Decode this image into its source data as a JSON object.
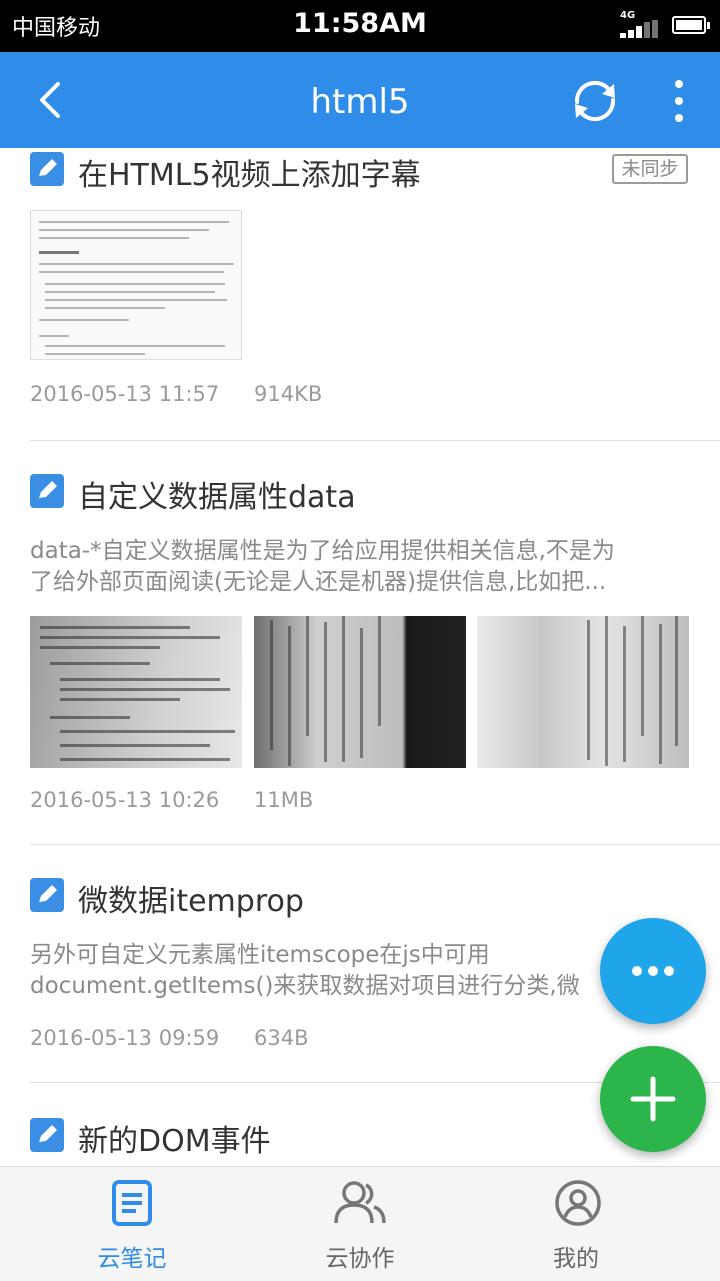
{
  "status_bar": {
    "carrier": "中国移动",
    "time": "11:58AM",
    "network": "4G"
  },
  "app_bar": {
    "title": "html5",
    "back_icon": "chevron-left-icon",
    "sync_icon": "sync-icon",
    "more_icon": "more-vertical-icon"
  },
  "notes": [
    {
      "title": "在HTML5视频上添加字幕",
      "badge": "未同步",
      "snippet": "",
      "date": "2016-05-13 11:57",
      "size": "914KB"
    },
    {
      "title": "自定义数据属性data",
      "badge": "",
      "snippet": "data-*自定义数据属性是为了给应用提供相关信息,不是为了给外部页面阅读(无论是人还是机器)提供信息,比如把...",
      "snippet_line1": "data-*自定义数据属性是为了给应用提供相关信息,不是为",
      "snippet_line2": "了给外部页面阅读(无论是人还是机器)提供信息,比如把...",
      "date": "2016-05-13 10:26",
      "size": "11MB"
    },
    {
      "title": "微数据itemprop",
      "badge": "",
      "snippet_line1": "另外可自定义元素属性itemscope在js中可用",
      "snippet_line2": "document.getItems()来获取数据对项目进行分类,微",
      "date": "2016-05-13 09:59",
      "size": "634B"
    },
    {
      "title": "新的DOM事件",
      "badge": ""
    }
  ],
  "fab": {
    "more_icon": "more-horizontal-icon",
    "add_icon": "plus-icon"
  },
  "tabs": [
    {
      "label": "云笔记",
      "icon": "note-icon",
      "active": true
    },
    {
      "label": "云协作",
      "icon": "people-icon",
      "active": false
    },
    {
      "label": "我的",
      "icon": "user-circle-icon",
      "active": false
    }
  ],
  "colors": {
    "app_bar": "#2f8ce9",
    "fab_more": "#1fa5ea",
    "fab_add": "#2cb54a",
    "tab_active": "#2f8ce9"
  }
}
